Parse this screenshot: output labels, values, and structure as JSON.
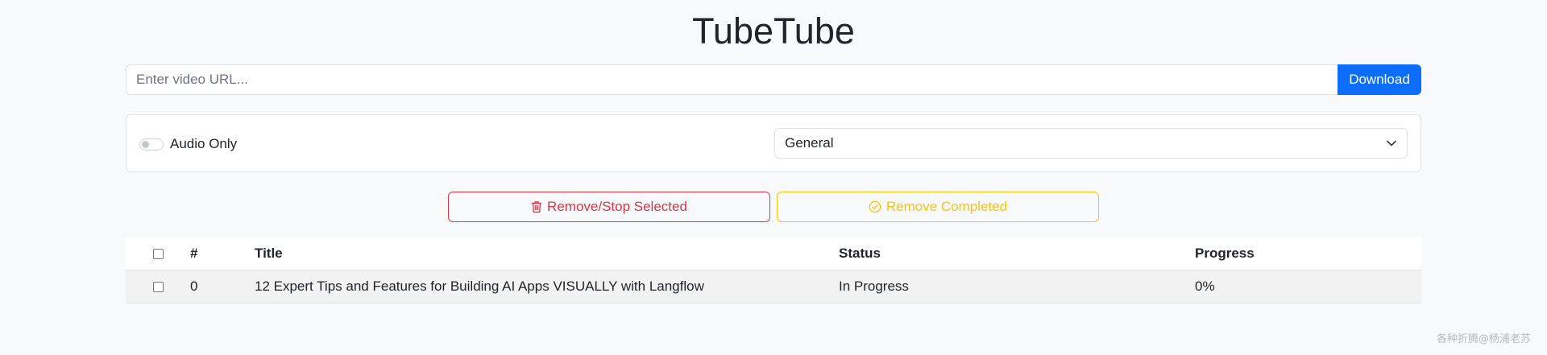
{
  "app": {
    "title": "TubeTube"
  },
  "url_bar": {
    "placeholder": "Enter video URL...",
    "value": "",
    "download_label": "Download"
  },
  "options": {
    "audio_only_label": "Audio Only",
    "audio_only_checked": false,
    "profile_selected": "General"
  },
  "actions": {
    "remove_stop_label": "Remove/Stop Selected",
    "remove_stop_icon": "trash-icon",
    "remove_completed_label": "Remove Completed",
    "remove_completed_icon": "check-circle-icon"
  },
  "table": {
    "headers": {
      "number": "#",
      "title": "Title",
      "status": "Status",
      "progress": "Progress"
    },
    "rows": [
      {
        "number": "0",
        "title": "12 Expert Tips and Features for Building AI Apps VISUALLY with Langflow",
        "status": "In Progress",
        "progress": "0%"
      }
    ]
  },
  "watermark": "各种折腾@杨浦老苏",
  "colors": {
    "primary": "#0d6efd",
    "danger": "#dc3545",
    "warning": "#ffc107",
    "background": "#f8f9fa"
  }
}
